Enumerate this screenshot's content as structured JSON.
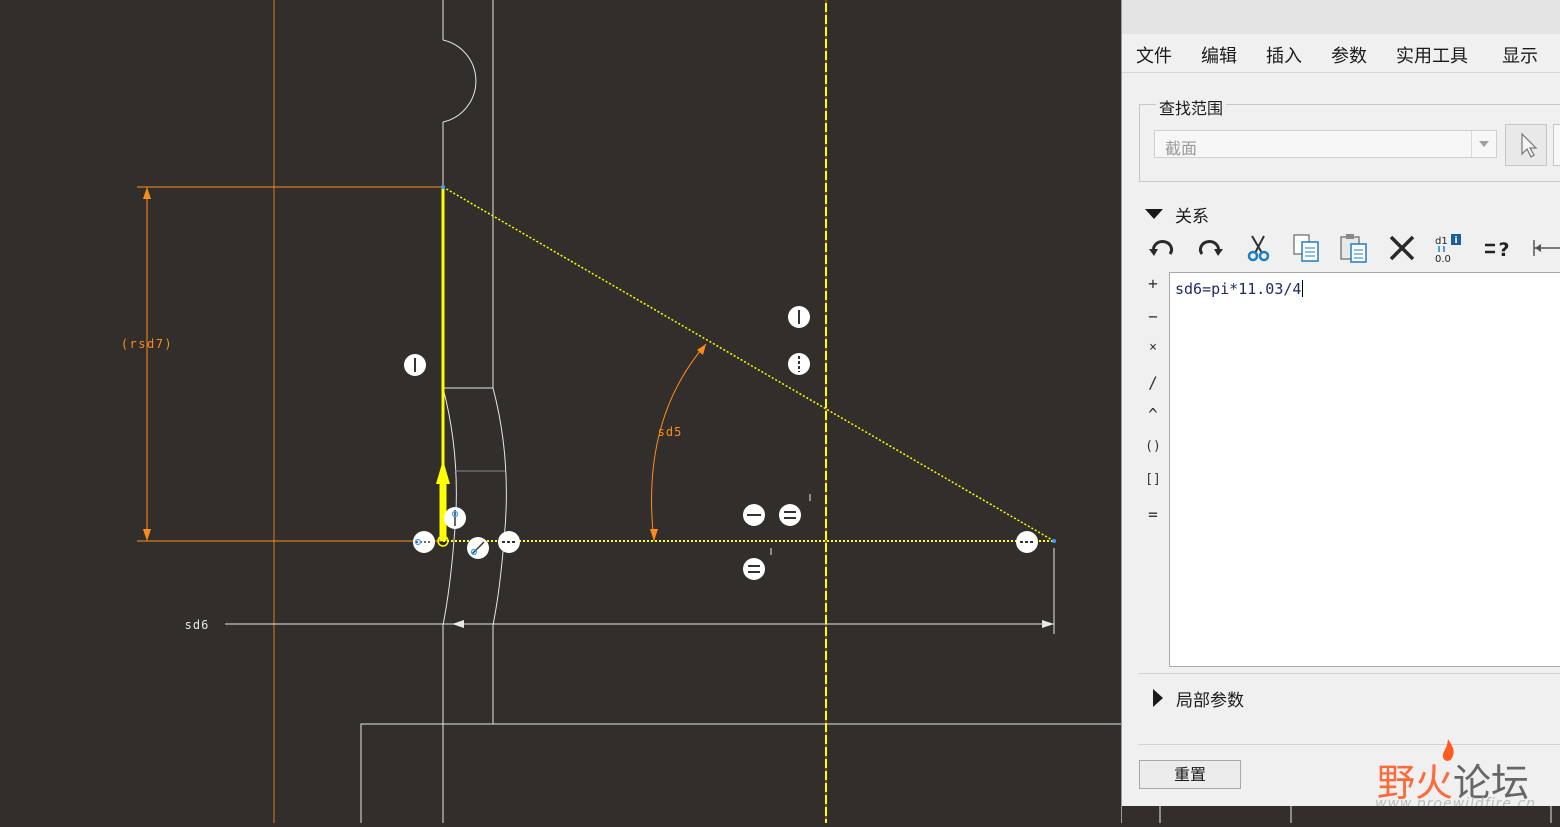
{
  "colors": {
    "canvas_bg": "#312e2b",
    "sketch_white": "#ffffff",
    "dimension_orange": "#ff8c1a",
    "highlight_yellow": "#ffff00",
    "panel_bg": "#f0f0f0",
    "watermark_orange": "#ff6a3a"
  },
  "canvas": {
    "dimensions": {
      "rsd7": "(rsd7)",
      "sd5": "sd5",
      "sd6": "sd6"
    }
  },
  "menu": {
    "items": [
      "文件",
      "编辑",
      "插入",
      "参数",
      "实用工具",
      "显示"
    ]
  },
  "search_scope": {
    "legend": "查找范围",
    "value": "截面"
  },
  "relations": {
    "header": "关系",
    "toolbar_icons": [
      "undo-icon",
      "redo-icon",
      "cut-icon",
      "copy-icon",
      "paste-icon",
      "delete-icon",
      "evaluate-icon",
      "verify-icon",
      "dimension-icon"
    ],
    "operators": [
      "+",
      "−",
      "×",
      "/",
      "^",
      "()",
      "[]",
      "="
    ],
    "text": "sd6=pi*11.03/4"
  },
  "local_params": {
    "header": "局部参数"
  },
  "buttons": {
    "reset": "重置"
  },
  "watermark": {
    "logo_part1": "野火",
    "logo_part2": "论坛",
    "url": "www.proewildfire.cn"
  }
}
